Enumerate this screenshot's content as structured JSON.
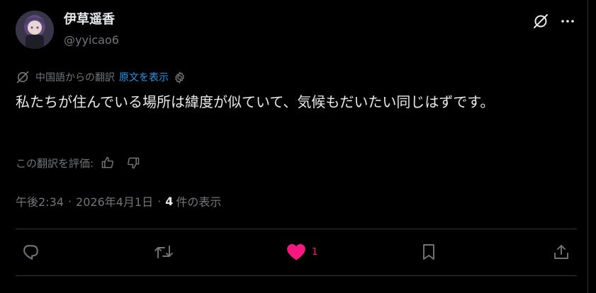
{
  "author": {
    "name": "伊草遥香",
    "handle": "@yyicao6"
  },
  "translation": {
    "from_label": "中国語からの翻訳",
    "show_original": "原文を表示"
  },
  "tweet": {
    "text": "私たちが住んでいる場所は緯度が似ていて、気候もだいたい同じはずです。"
  },
  "rating": {
    "label": "この翻訳を評価:"
  },
  "meta": {
    "time": "午後2:34",
    "date": "2026年4月1日",
    "views_count": "4",
    "views_label": "件の表示",
    "separator": "·"
  },
  "actions": {
    "like_count": "1"
  },
  "colors": {
    "background": "#000000",
    "link": "#1d9bf0",
    "like": "#f91880",
    "muted": "#71767b",
    "text": "#e7e9ea"
  },
  "icons": [
    "grok-icon",
    "more-icon",
    "translate-icon",
    "settings-icon",
    "thumbs-up-icon",
    "thumbs-down-icon",
    "reply-icon",
    "retweet-icon",
    "heart-icon",
    "bookmark-icon",
    "share-icon"
  ]
}
